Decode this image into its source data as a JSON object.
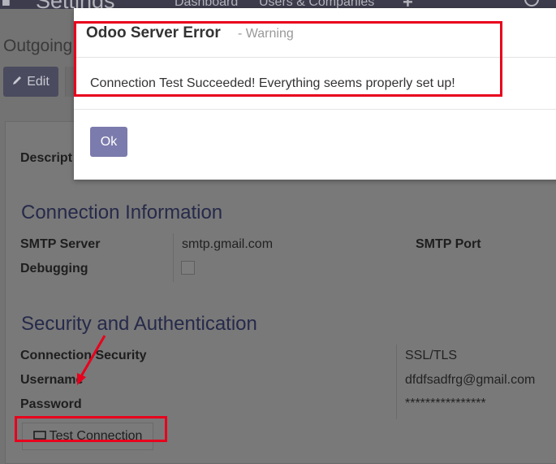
{
  "topbar": {
    "menu_icon": "app-menu-icon",
    "app_title": "Settings",
    "nav_dashboard": "Dashboard",
    "nav_users": "Users & Companies",
    "plus_icon": "plus-icon"
  },
  "breadcrumb": "Outgoing",
  "toolbar": {
    "edit_label": "Edit",
    "edit_icon": "pencil-icon"
  },
  "form": {
    "description_label": "Descript",
    "connection_section": "Connection Information",
    "smtp_server_label": "SMTP Server",
    "smtp_server_value": "smtp.gmail.com",
    "smtp_port_label": "SMTP Port",
    "debugging_label": "Debugging",
    "debugging_checked": false,
    "security_section": "Security and Authentication",
    "connection_security_label": "Connection Security",
    "connection_security_value": "SSL/TLS",
    "username_label": "Username",
    "username_value": "dfdfsadfrg@gmail.com",
    "password_label": "Password",
    "password_value": "****************",
    "test_connection_label": "Test Connection",
    "test_connection_icon": "monitor-icon"
  },
  "dialog": {
    "title": "Odoo Server Error",
    "subtitle": "- Warning",
    "message": "Connection Test Succeeded! Everything seems properly set up!",
    "ok_label": "Ok"
  },
  "colors": {
    "overlay_gray": "#737373",
    "accent_button": "#7c7bad",
    "section_title": "#262a4a",
    "annotation_red": "#e8001c"
  }
}
